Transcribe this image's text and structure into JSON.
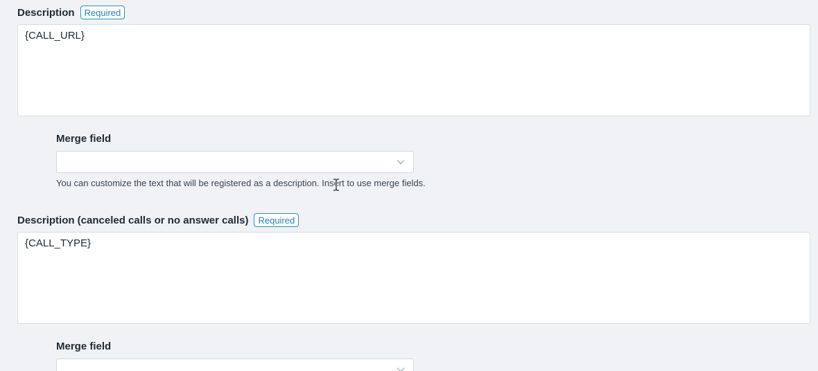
{
  "description": {
    "label": "Description",
    "required_badge": "Required",
    "value": "{CALL_URL}"
  },
  "merge_field_1": {
    "label": "Merge field",
    "selected_value": "",
    "help_text": "You can customize the text that will be registered as a description. Insert to use merge fields."
  },
  "description_canceled": {
    "label": "Description (canceled calls or no answer calls)",
    "required_badge": "Required",
    "value": "{CALL_TYPE}"
  },
  "merge_field_2": {
    "label": "Merge field",
    "selected_value": ""
  },
  "icons": {
    "select_arrow": "chevron-down-icon",
    "cursor": "text-cursor-icon"
  },
  "colors": {
    "background": "#f0f2f5",
    "badge_accent": "#2b8fc0",
    "text": "#222b36"
  }
}
